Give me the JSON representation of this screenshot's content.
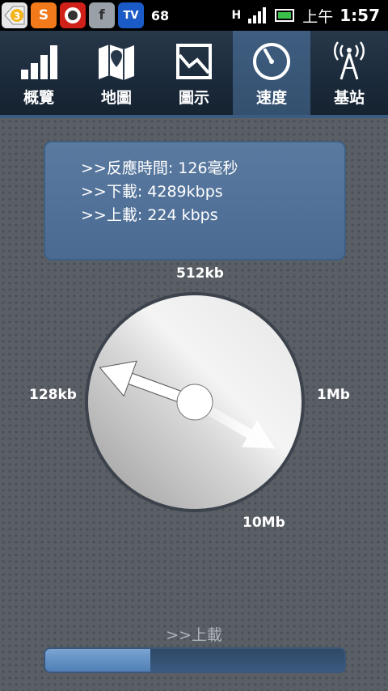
{
  "status_bar": {
    "notif_badge": "3",
    "notif_badge_2": "68",
    "ampm": "上午",
    "time": "1:57",
    "network": "H"
  },
  "tabs": [
    {
      "label": "概覽",
      "icon": "signal-bars-icon",
      "active": false
    },
    {
      "label": "地圖",
      "icon": "map-icon",
      "active": false
    },
    {
      "label": "圖示",
      "icon": "graph-icon",
      "active": false
    },
    {
      "label": "速度",
      "icon": "speedometer-icon",
      "active": true
    },
    {
      "label": "基站",
      "icon": "cell-tower-icon",
      "active": false
    }
  ],
  "info": {
    "latency": ">>反應時間: 126毫秒",
    "download": ">>下載: 4289kbps",
    "upload": ">>上載: 224 kbps"
  },
  "dial": {
    "label_top": "512kb",
    "label_left": "128kb",
    "label_right": "1Mb",
    "label_bottom": "10Mb"
  },
  "status_text": ">>上載",
  "progress": 0.35,
  "colors": {
    "accent": "#3f5e80",
    "progress_fill": "#6a96c8"
  }
}
